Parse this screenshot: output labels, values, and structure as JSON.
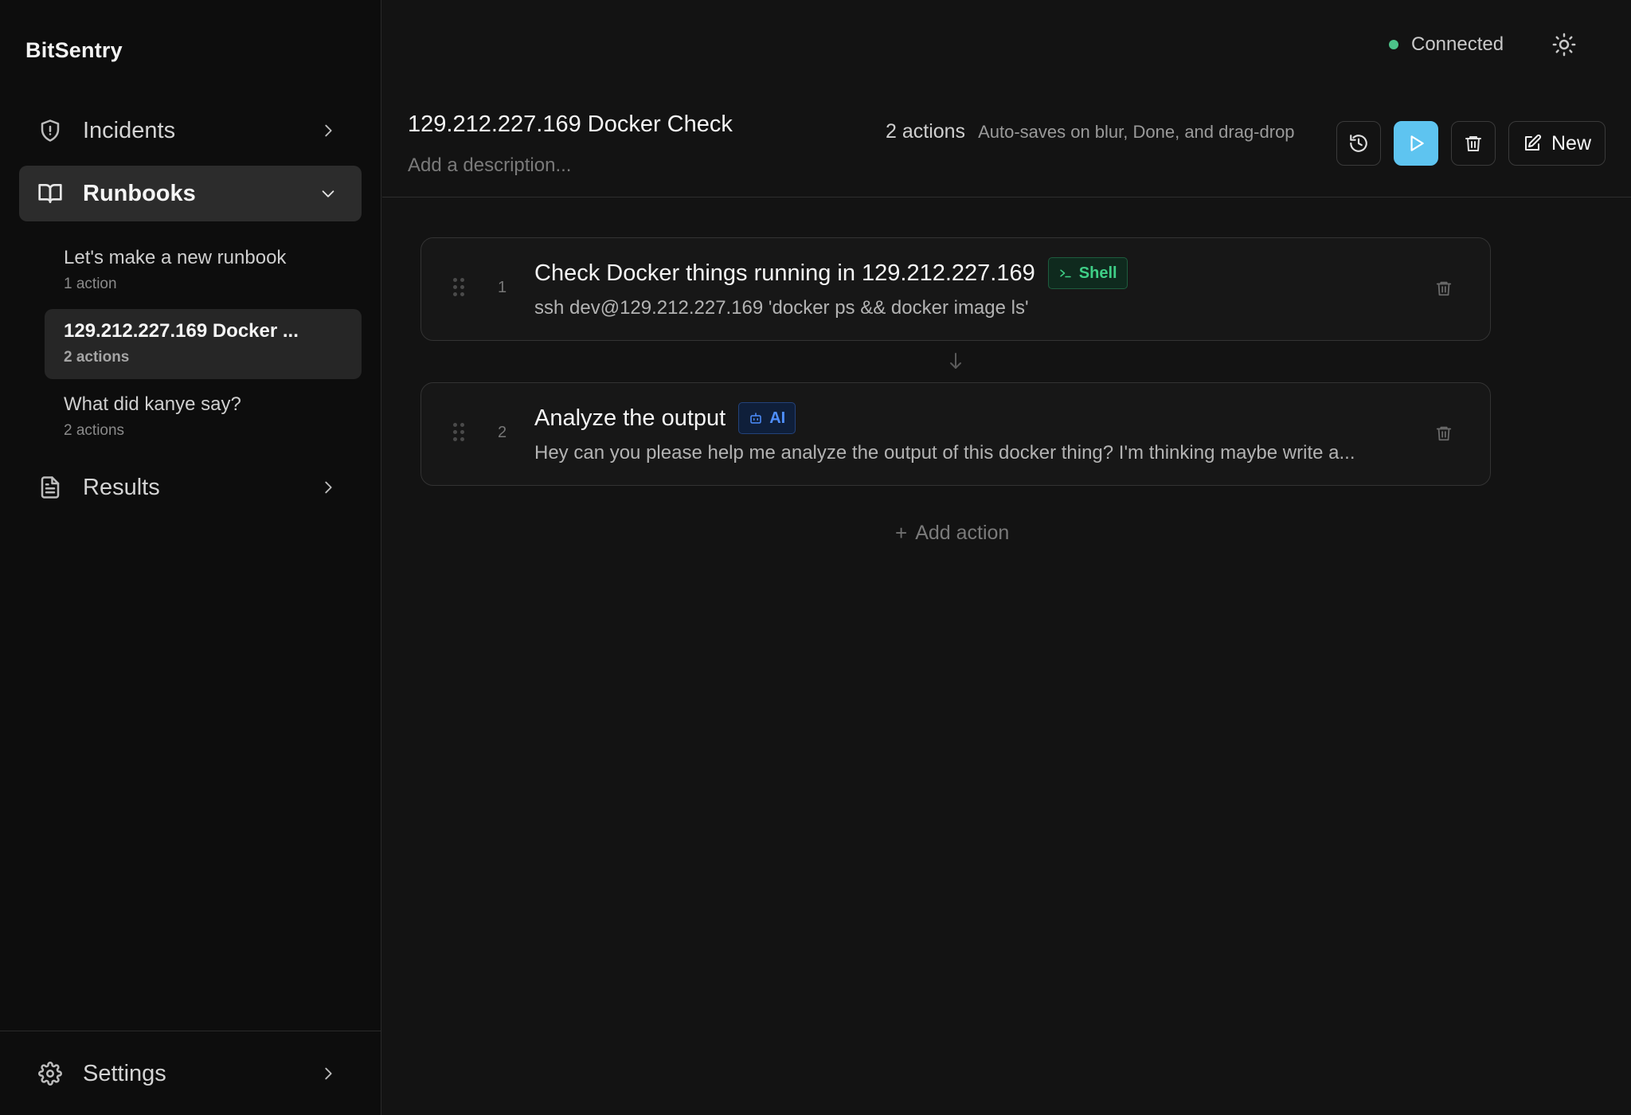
{
  "app": {
    "brand": "BitSentry"
  },
  "sidebar": {
    "nav": {
      "incidents": {
        "label": "Incidents",
        "icon": "shield-icon"
      },
      "runbooks": {
        "label": "Runbooks",
        "icon": "book-open-icon"
      },
      "results": {
        "label": "Results",
        "icon": "file-text-icon"
      },
      "settings": {
        "label": "Settings",
        "icon": "gear-icon"
      }
    },
    "runbooks": [
      {
        "title": "Let's make a new runbook",
        "subtitle": "1 action"
      },
      {
        "title": "129.212.227.169 Docker ...",
        "subtitle": "2 actions"
      },
      {
        "title": "What did kanye say?",
        "subtitle": "2 actions"
      }
    ]
  },
  "topbar": {
    "status_text": "Connected",
    "status_color": "#4cc38a"
  },
  "runbook": {
    "title": "129.212.227.169 Docker Check",
    "description_placeholder": "Add a description...",
    "action_count": "2 actions",
    "autosave_hint": "Auto-saves on blur, Done, and drag-drop",
    "new_button_label": "New",
    "accent_color": "#5ec4f0"
  },
  "actions": [
    {
      "number": "1",
      "title": "Check Docker things running in 129.212.227.169",
      "badge": "Shell",
      "badge_icon": "terminal-icon",
      "description": "ssh dev@129.212.227.169 'docker ps && docker image ls'"
    },
    {
      "number": "2",
      "title": "Analyze the output",
      "badge": "AI",
      "badge_icon": "bot-icon",
      "description": "Hey can you please help me analyze the output of this docker thing? I'm thinking maybe write a..."
    }
  ],
  "add_action": {
    "plus": "+",
    "label": "Add action"
  }
}
